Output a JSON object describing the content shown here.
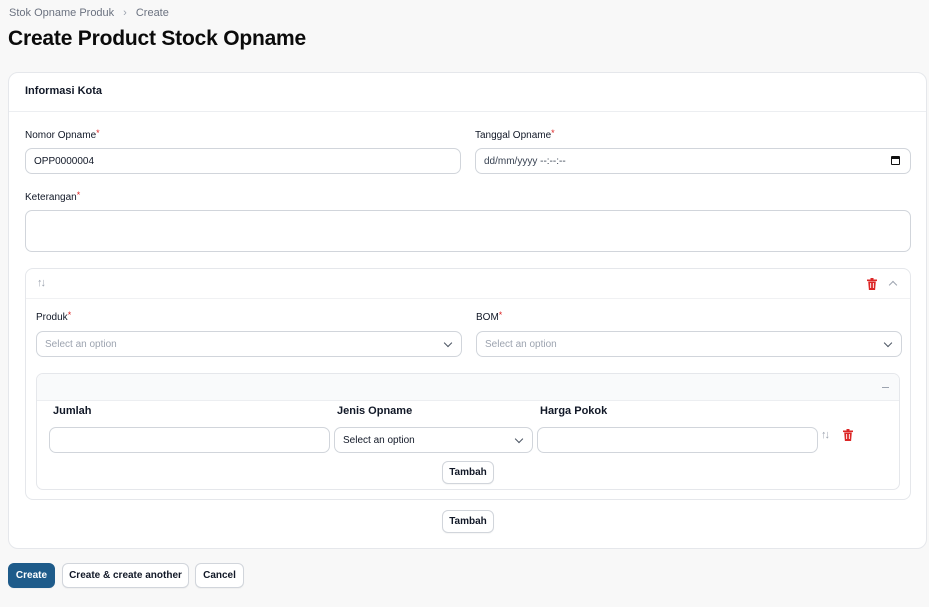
{
  "breadcrumb": {
    "parent": "Stok Opname Produk",
    "current": "Create"
  },
  "page": {
    "title": "Create Product Stock Opname"
  },
  "section": {
    "title": "Informasi Kota"
  },
  "form": {
    "nomor_label": "Nomor Opname",
    "nomor_value": "OPP0000004",
    "tanggal_label": "Tanggal Opname",
    "tanggal_value": "dd/mm/yyyy --:--:--",
    "keterangan_label": "Keterangan",
    "keterangan_value": "",
    "required_mark": "*"
  },
  "item": {
    "produk_label": "Produk",
    "produk_placeholder": "Select an option",
    "bom_label": "BOM",
    "bom_placeholder": "Select an option",
    "table": {
      "columns": [
        "Jumlah",
        "Jenis Opname",
        "Harga Pokok"
      ],
      "row": {
        "jumlah": "",
        "jenis_placeholder": "Select an option",
        "harga": ""
      },
      "add_label": "Tambah"
    }
  },
  "repeater": {
    "add_label": "Tambah"
  },
  "actions": {
    "create": "Create",
    "create_another": "Create & create another",
    "cancel": "Cancel"
  },
  "colors": {
    "primary": "#1e5b8a",
    "danger": "#dc2626",
    "required": "#dc2626"
  },
  "icons": {
    "breadcrumb_sep": "chevron-right-icon",
    "calendar": "calendar-icon",
    "select": "chevron-down-icon",
    "reorder": "arrows-up-down-icon",
    "delete": "trash-icon",
    "collapse": "chevron-up-icon",
    "table_collapse": "minus-icon"
  }
}
